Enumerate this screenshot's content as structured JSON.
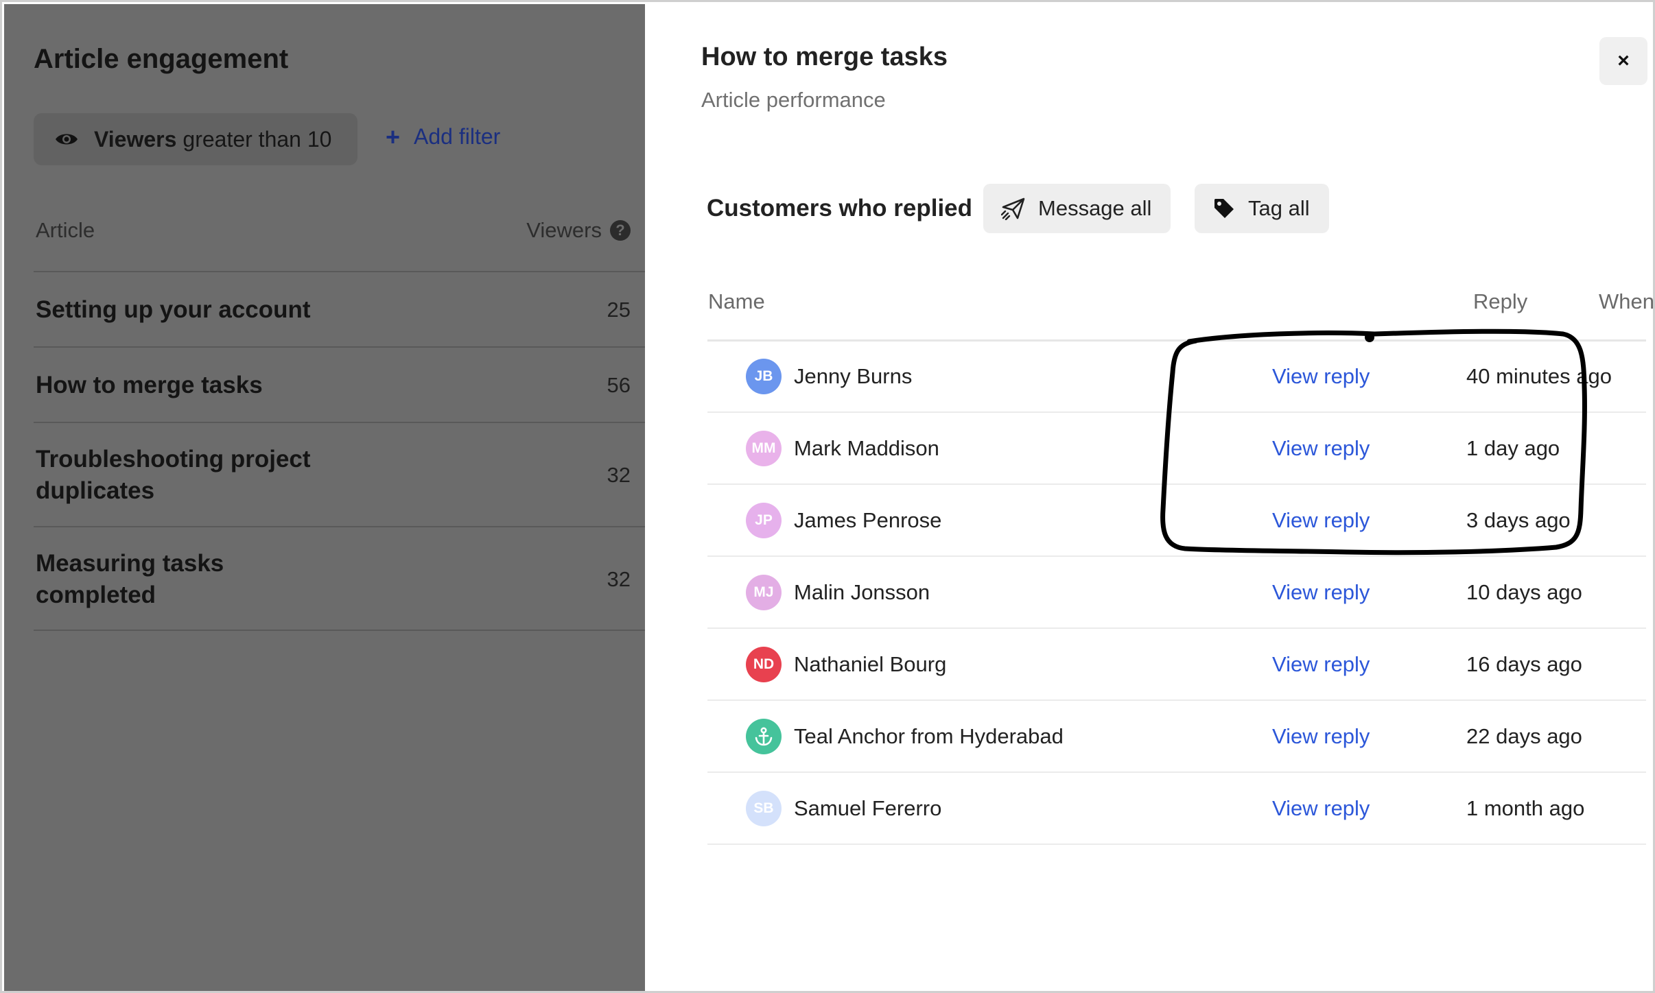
{
  "left_panel": {
    "title": "Article engagement",
    "filter": {
      "strong": "Viewers",
      "rest": "greater than 10"
    },
    "add_filter_label": "Add filter",
    "columns": {
      "article": "Article",
      "viewers": "Viewers"
    },
    "articles": [
      {
        "lines": [
          "Setting up your account"
        ],
        "viewers": "25"
      },
      {
        "lines": [
          "How to merge tasks"
        ],
        "viewers": "56"
      },
      {
        "lines": [
          "Troubleshooting project",
          "duplicates"
        ],
        "viewers": "32"
      },
      {
        "lines": [
          "Measuring tasks",
          "completed"
        ],
        "viewers": "32"
      }
    ]
  },
  "panel": {
    "title": "How to merge tasks",
    "subtitle": "Article performance",
    "close_label": "×",
    "section_title": "Customers who replied",
    "message_all_label": "Message all",
    "tag_all_label": "Tag all",
    "columns": {
      "name": "Name",
      "reply": "Reply",
      "when": "When they replied"
    },
    "customers": [
      {
        "initials": "JB",
        "name": "Jenny Burns",
        "reply": "View reply",
        "when": "40 minutes ago",
        "avatar_color": "#6b96ee"
      },
      {
        "initials": "MM",
        "name": "Mark Maddison",
        "reply": "View reply",
        "when": "1 day ago",
        "avatar_color": "#e9b2ea"
      },
      {
        "initials": "JP",
        "name": "James Penrose",
        "reply": "View reply",
        "when": "3 days ago",
        "avatar_color": "#e6b1ec"
      },
      {
        "initials": "MJ",
        "name": "Malin Jonsson",
        "reply": "View reply",
        "when": "10 days ago",
        "avatar_color": "#e3aee5"
      },
      {
        "initials": "ND",
        "name": "Nathaniel Bourg",
        "reply": "View reply",
        "when": "16 days ago",
        "avatar_color": "#e8414f"
      },
      {
        "initials": "",
        "name": "Teal Anchor from Hyderabad",
        "reply": "View reply",
        "when": "22 days ago",
        "avatar_color": "#45c39b",
        "avatar_icon": "anchor-icon"
      },
      {
        "initials": "SB",
        "name": "Samuel Fererro",
        "reply": "View reply",
        "when": "1 month ago",
        "avatar_color": "#d4e1fb"
      }
    ]
  },
  "icons": {
    "filter": "eye-icon",
    "add": "plus-icon",
    "help": "question-icon",
    "message": "paper-plane-icon",
    "tag": "tag-icon",
    "close": "close-icon"
  },
  "annotation": {
    "color": "#000000"
  }
}
